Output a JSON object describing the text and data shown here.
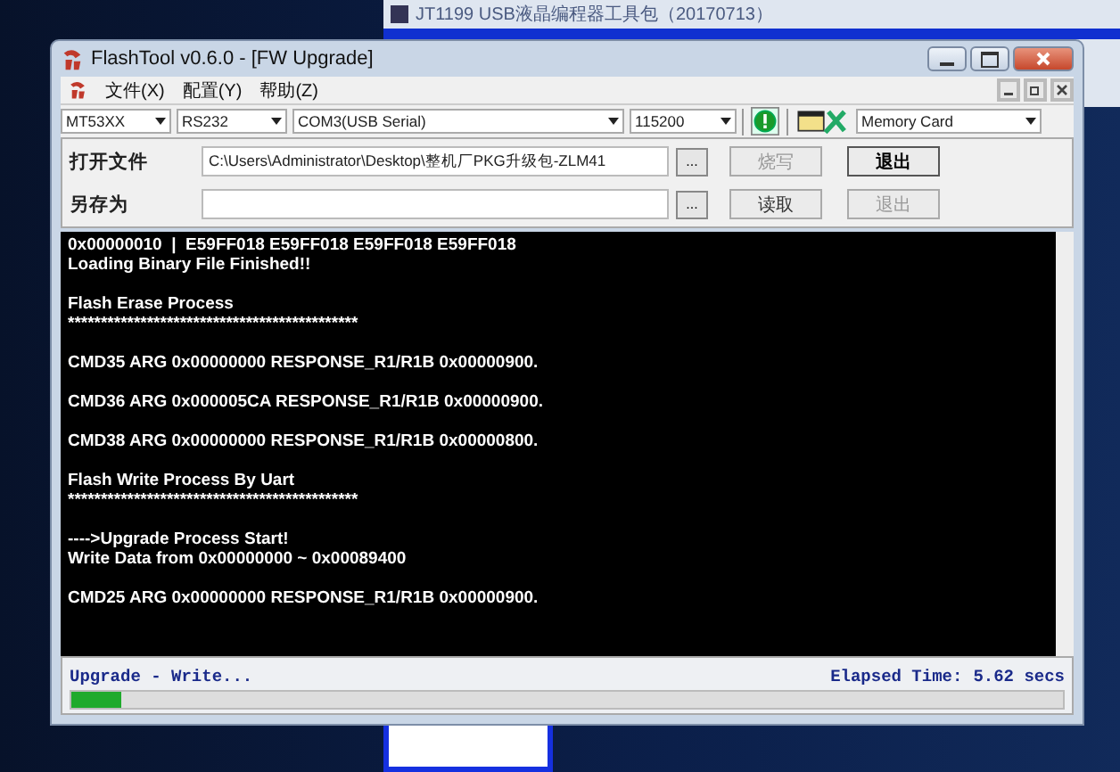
{
  "background_window": {
    "title": "JT1199 USB液晶编程器工具包（20170713）"
  },
  "window": {
    "title": "FlashTool v0.6.0 - [FW Upgrade]"
  },
  "menu": [
    {
      "label": "文件(X)"
    },
    {
      "label": "配置(Y)"
    },
    {
      "label": "帮助(Z)"
    }
  ],
  "toolbar": {
    "combos": [
      {
        "value": "MT53XX",
        "kind": "short"
      },
      {
        "value": "RS232",
        "kind": "short"
      },
      {
        "value": "COM3(USB Serial)",
        "kind": "long"
      },
      {
        "value": "115200",
        "kind": "medium"
      }
    ],
    "storage": {
      "value": "Memory Card"
    }
  },
  "file_rows": [
    {
      "label": "打开文件",
      "value": "C:\\Users\\Administrator\\Desktop\\整机厂PKG升级包-ZLM41",
      "browse": "...",
      "buttons": [
        {
          "label": "烧写",
          "disabled": true
        },
        {
          "label": "退出",
          "disabled": false
        }
      ]
    },
    {
      "label": "另存为",
      "browse": "...",
      "buttons": [
        {
          "label": "读取",
          "disabled": false
        },
        {
          "label": "退出",
          "disabled": true
        }
      ]
    }
  ],
  "console": [
    [
      "0x00000010  |  E59FF018 E59FF018 E59FF018 E59FF018",
      "Loading Binary File Finished!!"
    ],
    [
      "Flash Erase Process",
      "********************************************"
    ],
    [
      "CMD35 ARG 0x00000000 RESPONSE_R1/R1B 0x00000900."
    ],
    [
      "CMD36 ARG 0x000005CA RESPONSE_R1/R1B 0x00000900."
    ],
    [
      "CMD38 ARG 0x00000000 RESPONSE_R1/R1B 0x00000800."
    ],
    [
      "Flash Write Process By Uart",
      "********************************************"
    ],
    [
      "---->Upgrade Process Start!",
      "Write Data from 0x00000000 ~ 0x00089400"
    ],
    [
      "CMD25 ARG 0x00000000 RESPONSE_R1/R1B 0x00000900."
    ]
  ],
  "status_bar": {
    "status": "Upgrade - Write...",
    "elapsed_label": "Elapsed Time:",
    "elapsed_value": "5.62 secs",
    "progress": {
      "level": 0.05
    }
  }
}
